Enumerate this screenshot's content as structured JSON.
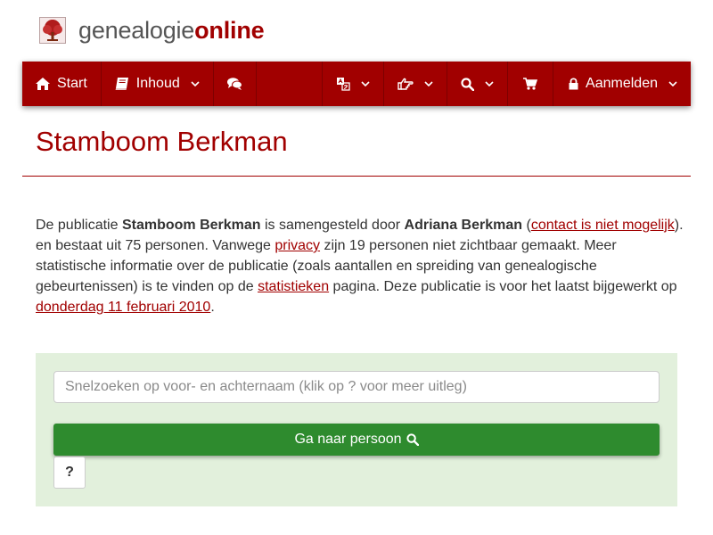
{
  "brand": {
    "logo_icon": "tree-logo-icon",
    "name_part1": "genealogie",
    "name_part2": "online",
    "color": "#a10000"
  },
  "nav": {
    "start_label": "Start",
    "start_icon": "home-icon",
    "inhoud_label": "Inhoud",
    "inhoud_icon": "book-icon",
    "chat_icon": "comments-icon",
    "language_icon": "language-icon",
    "hand_icon": "hand-pointer-icon",
    "search_icon": "search-icon",
    "cart_icon": "shopping-cart-icon",
    "login_label": "Aanmelden",
    "login_icon": "lock-icon",
    "background": "#a10000"
  },
  "page": {
    "title": "Stamboom Berkman"
  },
  "intro": {
    "t1": "De publicatie ",
    "publication": "Stamboom Berkman",
    "t2": " is samengesteld door ",
    "author": "Adriana Berkman",
    "t3": " (",
    "contact_link": "contact is niet mogelijk",
    "t4": "). en bestaat uit 75 personen. Vanwege ",
    "privacy_link": "privacy",
    "t5": " zijn 19 personen niet zichtbaar gemaakt. Meer statistische informatie over de publicatie (zoals aantallen en spreiding van genealogische gebeurtenissen) is te vinden op de ",
    "stats_link": "statistieken",
    "t6": " pagina. Deze publicatie is voor het laatst bijgewerkt op ",
    "date_link": "donderdag 11 februari 2010",
    "t7": "."
  },
  "search": {
    "placeholder": "Snelzoeken op voor- en achternaam (klik op ? voor meer uitleg)",
    "go_label": "Ga naar persoon",
    "help_label": "?",
    "panel_color": "#e2f0dc",
    "button_color": "#2e8b2e"
  }
}
